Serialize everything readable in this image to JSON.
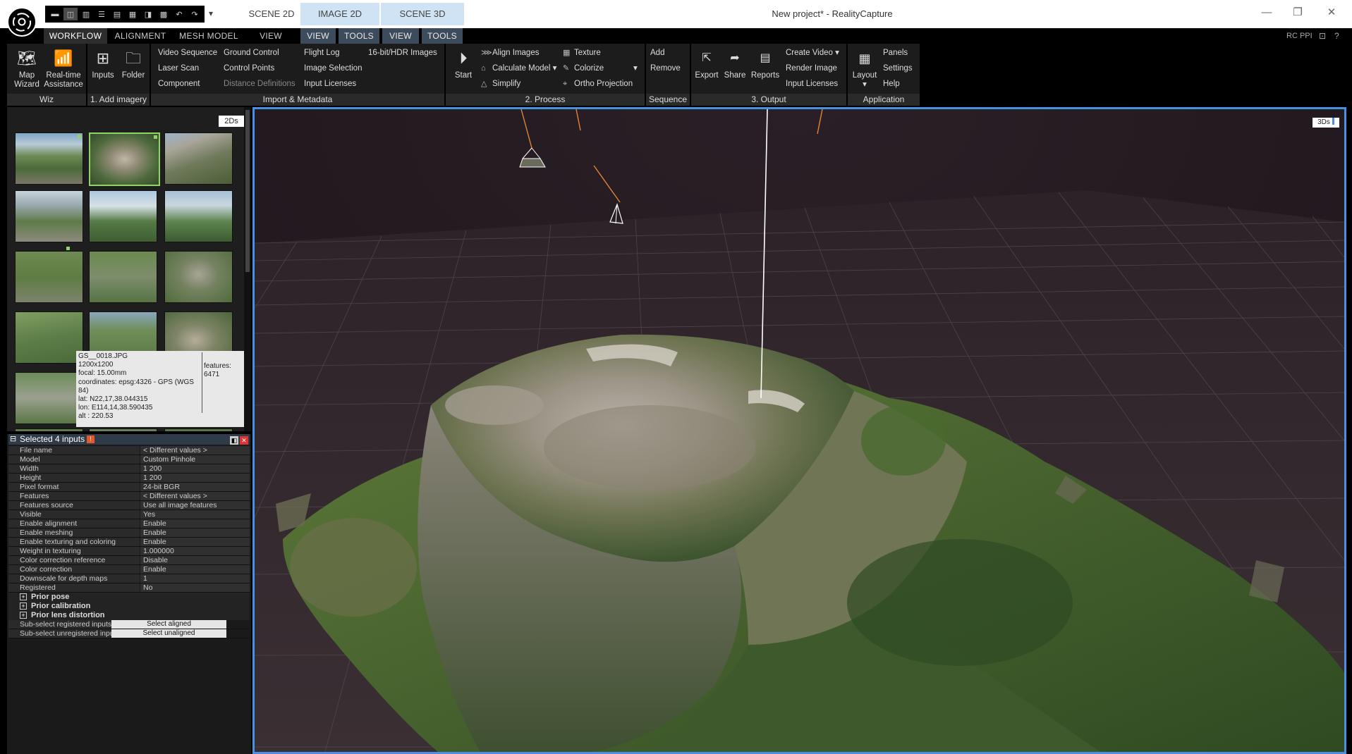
{
  "window": {
    "title": "New project* - RealityCapture",
    "buttons": {
      "minimize": "—",
      "restore": "❐",
      "close": "✕"
    }
  },
  "scene_tabs": [
    "SCENE 2D",
    "IMAGE 2D",
    "SCENE 3D"
  ],
  "menu": {
    "tabs": [
      "WORKFLOW",
      "ALIGNMENT",
      "MESH MODEL",
      "VIEW"
    ],
    "context_tabs": [
      "VIEW",
      "TOOLS",
      "VIEW",
      "TOOLS"
    ],
    "right_label": "RC PPI",
    "right_icons": {
      "pin": "⊡",
      "help": "?"
    }
  },
  "ribbon": {
    "wiz": {
      "title": "Wiz",
      "map_wizard": [
        "Map",
        "Wizard"
      ],
      "realtime": [
        "Real-time",
        "Assistance"
      ]
    },
    "add_imagery": {
      "title": "1. Add imagery",
      "inputs": "Inputs",
      "folder": "Folder"
    },
    "import_metadata": {
      "title": "Import & Metadata",
      "col1": [
        "Video Sequence",
        "Laser Scan",
        "Component"
      ],
      "col2": [
        "Ground Control",
        "Control Points",
        "Distance Definitions"
      ],
      "col3": [
        "Flight Log",
        "Image Selection",
        "Input Licenses"
      ],
      "col4": [
        "16-bit/HDR Images"
      ]
    },
    "process": {
      "title": "2. Process",
      "start": "Start",
      "col1": [
        "Align Images",
        "Calculate Model",
        "Simplify"
      ],
      "col2": [
        "Texture",
        "Colorize",
        "Ortho Projection"
      ]
    },
    "sequence": {
      "title": "Sequence",
      "items": [
        "Add",
        "Remove"
      ]
    },
    "output": {
      "title": "3. Output",
      "export": "Export",
      "share": "Share",
      "reports": "Reports",
      "col": [
        "Create Video",
        "Render Image",
        "Input Licenses"
      ]
    },
    "application": {
      "title": "Application",
      "layout": "Layout",
      "col": [
        "Panels",
        "Settings",
        "Help"
      ]
    }
  },
  "images_panel": {
    "tag": "2Ds",
    "tooltip": {
      "lines": [
        "GS__0018.JPG",
        "1200x1200",
        "focal: 15.00mm",
        "coordinates: epsg:4326 - GPS (WGS 84)",
        "lat: N22,17,38.044315",
        "lon: E114,14,38.590435",
        "alt : 220.53"
      ],
      "features_label": "features:",
      "features_value": "6471"
    }
  },
  "properties": {
    "header": "Selected 4 inputs",
    "header_warn": "!",
    "header_btns": [
      "◧",
      "✕"
    ],
    "rows": [
      {
        "k": "File name",
        "v": "< Different values >"
      },
      {
        "k": "Model",
        "v": "Custom Pinhole"
      },
      {
        "k": "Width",
        "v": "1 200"
      },
      {
        "k": "Height",
        "v": "1 200"
      },
      {
        "k": "Pixel format",
        "v": "24-bit BGR"
      },
      {
        "k": "Features",
        "v": "< Different values >"
      },
      {
        "k": "Features source",
        "v": "Use all image features"
      },
      {
        "k": "Visible",
        "v": "Yes"
      },
      {
        "k": "Enable alignment",
        "v": "Enable"
      },
      {
        "k": "Enable meshing",
        "v": "Enable"
      },
      {
        "k": "Enable texturing and coloring",
        "v": "Enable"
      },
      {
        "k": "Weight in texturing",
        "v": "1.000000"
      },
      {
        "k": "Color correction reference",
        "v": "Disable"
      },
      {
        "k": "Color correction",
        "v": "Enable"
      },
      {
        "k": "Downscale for depth maps",
        "v": "1"
      },
      {
        "k": "Registered",
        "v": "No"
      }
    ],
    "sections": [
      "Prior pose",
      "Prior calibration",
      "Prior lens distortion"
    ],
    "buttons": [
      {
        "k": "Sub-select registered inputs only",
        "v": "Select aligned"
      },
      {
        "k": "Sub-select unregistered inputs o...",
        "v": "Select unaligned"
      }
    ]
  },
  "viewport": {
    "tag": "3Ds"
  },
  "colors": {
    "accent": "#4a90e2",
    "selected": "#8fd464",
    "camera_ray": "#e0843a"
  }
}
